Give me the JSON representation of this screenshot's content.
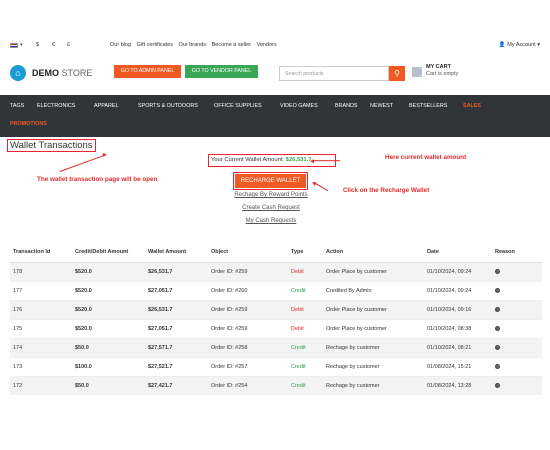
{
  "topbar": {
    "currencies": [
      "$",
      "€",
      "£"
    ],
    "links": [
      "Our blog",
      "Gift certificates",
      "Our brands",
      "Become a seller",
      "Vendors"
    ],
    "account": "My Account"
  },
  "header": {
    "logo_bold": "DEMO",
    "logo_light": "STORE",
    "admin_btn": "GO TO ADMIN PANEL",
    "vendor_btn": "GO TO VENDOR PANEL",
    "search_placeholder": "Search products",
    "cart_title": "MY CART",
    "cart_sub": "Cart is empty"
  },
  "nav": {
    "items": [
      "TAGS",
      "ELECTRONICS",
      "APPAREL",
      "SPORTS & OUTDOORS",
      "OFFICE SUPPLIES",
      "VIDEO GAMES",
      "BRANDS",
      "NEWEST",
      "BESTSELLERS",
      "SALES"
    ],
    "row2": "PROMOTIONS"
  },
  "page": {
    "title": "Wallet Transactions",
    "wallet_label": "Your Current Wallet Amount:",
    "wallet_value": "$26,531.7",
    "recharge": "RECHARGE WALLET",
    "link1": "Rechage By Reward Points",
    "link2": "Create Cash Request",
    "link3": "My Cash Requests"
  },
  "notes": {
    "amount": "Here current wallet amount",
    "page": "The wallet transaction page will be open",
    "recharge": "Click on the Recharge Wallet"
  },
  "table": {
    "headers": [
      "Transaction Id",
      "Credit/Debit Amount",
      "Wallet Amount",
      "Object",
      "Type",
      "Action",
      "Date",
      "Reason"
    ],
    "rows": [
      [
        "178",
        "$520.0",
        "$26,531.7",
        "Order ID: #259",
        "Debit",
        "Order Place by customer",
        "01/10/2024, 09:24"
      ],
      [
        "177",
        "$520.0",
        "$27,051.7",
        "Order ID: #260",
        "Credit",
        "Credited By Admin",
        "01/10/2024, 09:24"
      ],
      [
        "176",
        "$520.0",
        "$26,531.7",
        "Order ID: #259",
        "Debit",
        "Order Place by customer",
        "01/10/2024, 09:16"
      ],
      [
        "175",
        "$520.0",
        "$27,051.7",
        "Order ID: #259",
        "Debit",
        "Order Place by customer",
        "01/10/2024, 08:38"
      ],
      [
        "174",
        "$50.0",
        "$27,571.7",
        "Order ID: #258",
        "Credit",
        "Rechage by customer",
        "01/10/2024, 08:21"
      ],
      [
        "173",
        "$100.0",
        "$27,521.7",
        "Order ID: #257",
        "Credit",
        "Rechage by customer",
        "01/08/2024, 15:21"
      ],
      [
        "172",
        "$50.0",
        "$27,421.7",
        "Order ID: #254",
        "Credit",
        "Rechage by customer",
        "01/08/2024, 13:28"
      ]
    ]
  },
  "colors": {
    "accent": "#f05a22",
    "green": "#3aa657",
    "nav_bg": "#2f353b",
    "annotation": "#e02b2b"
  }
}
